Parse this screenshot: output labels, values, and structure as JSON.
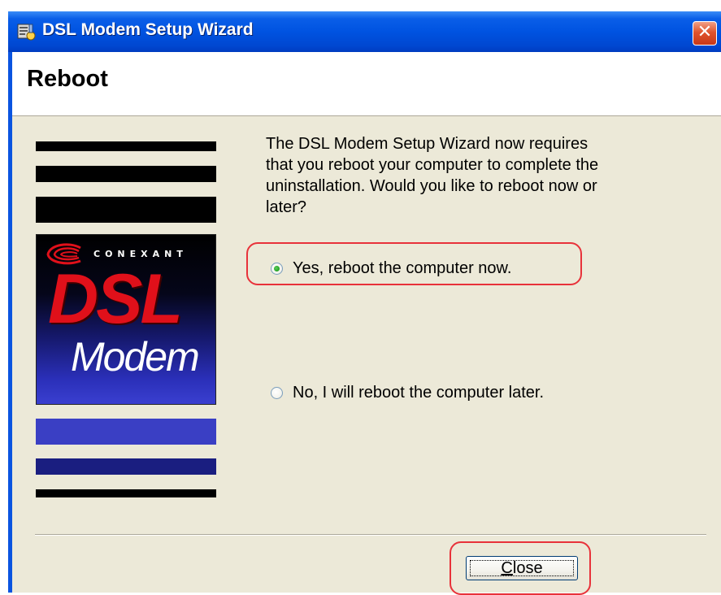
{
  "window": {
    "title": "DSL Modem Setup Wizard",
    "close_icon": "close-icon",
    "app_icon": "wizard-setup-icon"
  },
  "header": {
    "title": "Reboot"
  },
  "banner": {
    "logo": {
      "brand": "CONEXANT",
      "product_line1": "DSL",
      "product_line2": "Modem"
    }
  },
  "message": "The DSL Modem Setup Wizard now requires\nthat you reboot your computer to complete the\nuninstallation.  Would you like to reboot now or\nlater?",
  "options": {
    "selected": "yes",
    "yes_label": "Yes, reboot the computer now.",
    "no_label": "No, I will reboot the computer later."
  },
  "buttons": {
    "close_mnemonic": "C",
    "close_rest": "lose"
  },
  "colors": {
    "titlebar": "#0053e1",
    "dialog_bg": "#ece9d8",
    "highlight": "#e8323a",
    "logo_red": "#e0101a"
  }
}
